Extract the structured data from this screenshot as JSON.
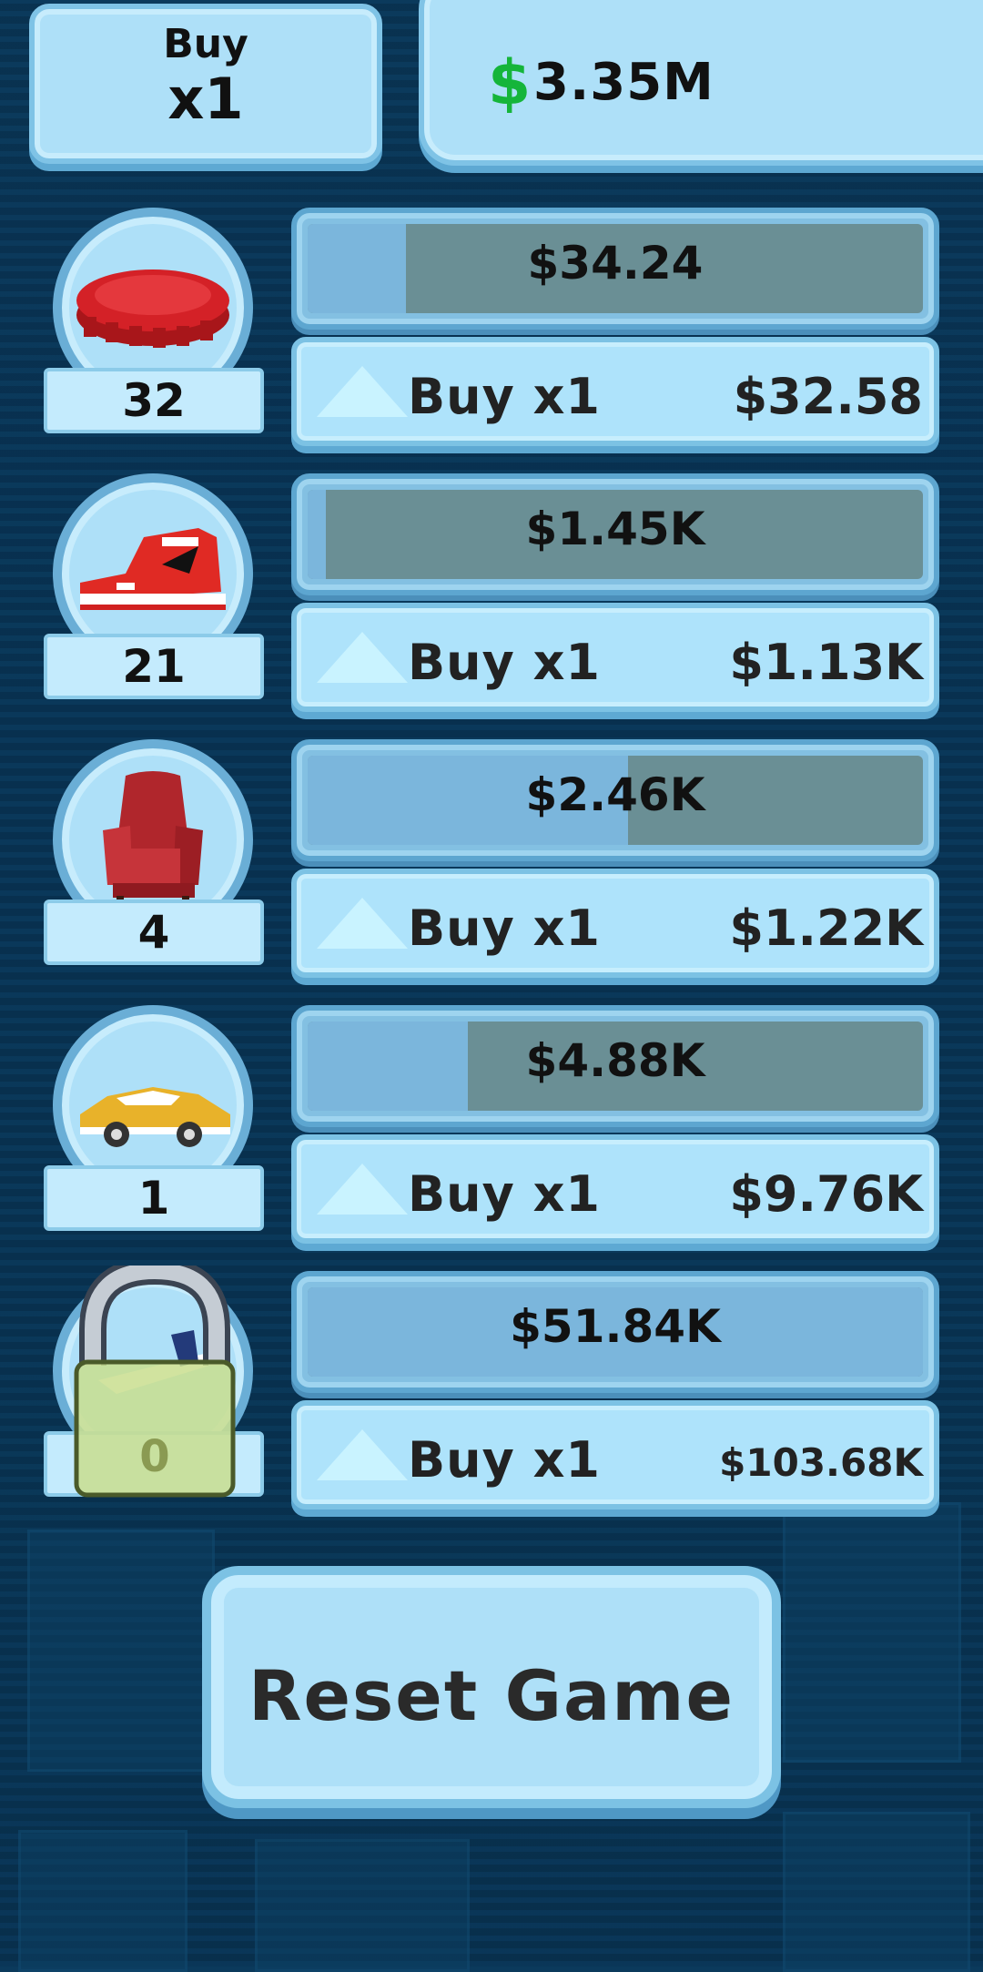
{
  "header": {
    "buy_label": "Buy",
    "buy_multiplier": "x1",
    "currency_symbol": "$",
    "money": "3.35M"
  },
  "businesses": [
    {
      "icon": "bottle-cap-icon",
      "count": "32",
      "progress_value": "$34.24",
      "progress": 0.16,
      "buy_label": "Buy x1",
      "cost": "$32.58",
      "locked": false
    },
    {
      "icon": "sneaker-icon",
      "count": "21",
      "progress_value": "$1.45K",
      "progress": 0.03,
      "buy_label": "Buy x1",
      "cost": "$1.13K",
      "locked": false
    },
    {
      "icon": "armchair-icon",
      "count": "4",
      "progress_value": "$2.46K",
      "progress": 0.52,
      "buy_label": "Buy x1",
      "cost": "$1.22K",
      "locked": false
    },
    {
      "icon": "sports-car-icon",
      "count": "1",
      "progress_value": "$4.88K",
      "progress": 0.26,
      "buy_label": "Buy x1",
      "cost": "$9.76K",
      "locked": false
    },
    {
      "icon": "airplane-icon",
      "count": "0",
      "progress_value": "$51.84K",
      "progress": 1.0,
      "buy_label": "Buy x1",
      "cost": "$103.68K",
      "locked": true
    }
  ],
  "reset_label": "Reset Game",
  "colors": {
    "money_green": "#15b53a",
    "panel_light": "#aee0f8",
    "progress_gray": "#6a8f95",
    "background": "#0b3a5c"
  }
}
